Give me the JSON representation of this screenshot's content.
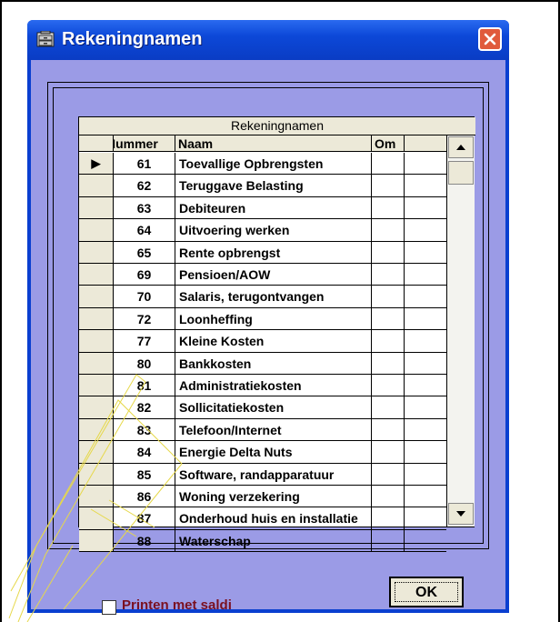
{
  "window": {
    "title": "Rekeningnamen"
  },
  "grid": {
    "caption": "Rekeningnamen",
    "columns": {
      "number": "Nummer",
      "name": "Naam",
      "om": "Om"
    },
    "current_row_marker": "▶",
    "rows": [
      {
        "number": "61",
        "name": "Toevallige Opbrengsten"
      },
      {
        "number": "62",
        "name": "Teruggave Belasting"
      },
      {
        "number": "63",
        "name": "Debiteuren"
      },
      {
        "number": "64",
        "name": "Uitvoering werken"
      },
      {
        "number": "65",
        "name": "Rente opbrengst"
      },
      {
        "number": "69",
        "name": "Pensioen/AOW"
      },
      {
        "number": "70",
        "name": "Salaris, terugontvangen"
      },
      {
        "number": "72",
        "name": "Loonheffing"
      },
      {
        "number": "77",
        "name": "Kleine Kosten"
      },
      {
        "number": "80",
        "name": "Bankkosten"
      },
      {
        "number": "81",
        "name": "Administratiekosten"
      },
      {
        "number": "82",
        "name": "Sollicitatiekosten"
      },
      {
        "number": "83",
        "name": "Telefoon/Internet"
      },
      {
        "number": "84",
        "name": "Energie Delta Nuts"
      },
      {
        "number": "85",
        "name": "Software, randapparatuur"
      },
      {
        "number": "86",
        "name": "Woning verzekering"
      },
      {
        "number": "87",
        "name": "Onderhoud huis en installatie"
      },
      {
        "number": "88",
        "name": "Waterschap"
      }
    ]
  },
  "print_checkbox": {
    "label": "Printen met saldi",
    "checked": false
  },
  "ok_button": {
    "label": "OK"
  },
  "colors": {
    "client": "#9b9be6",
    "titlebar": "#0a3fd0",
    "label": "#7a1020"
  }
}
